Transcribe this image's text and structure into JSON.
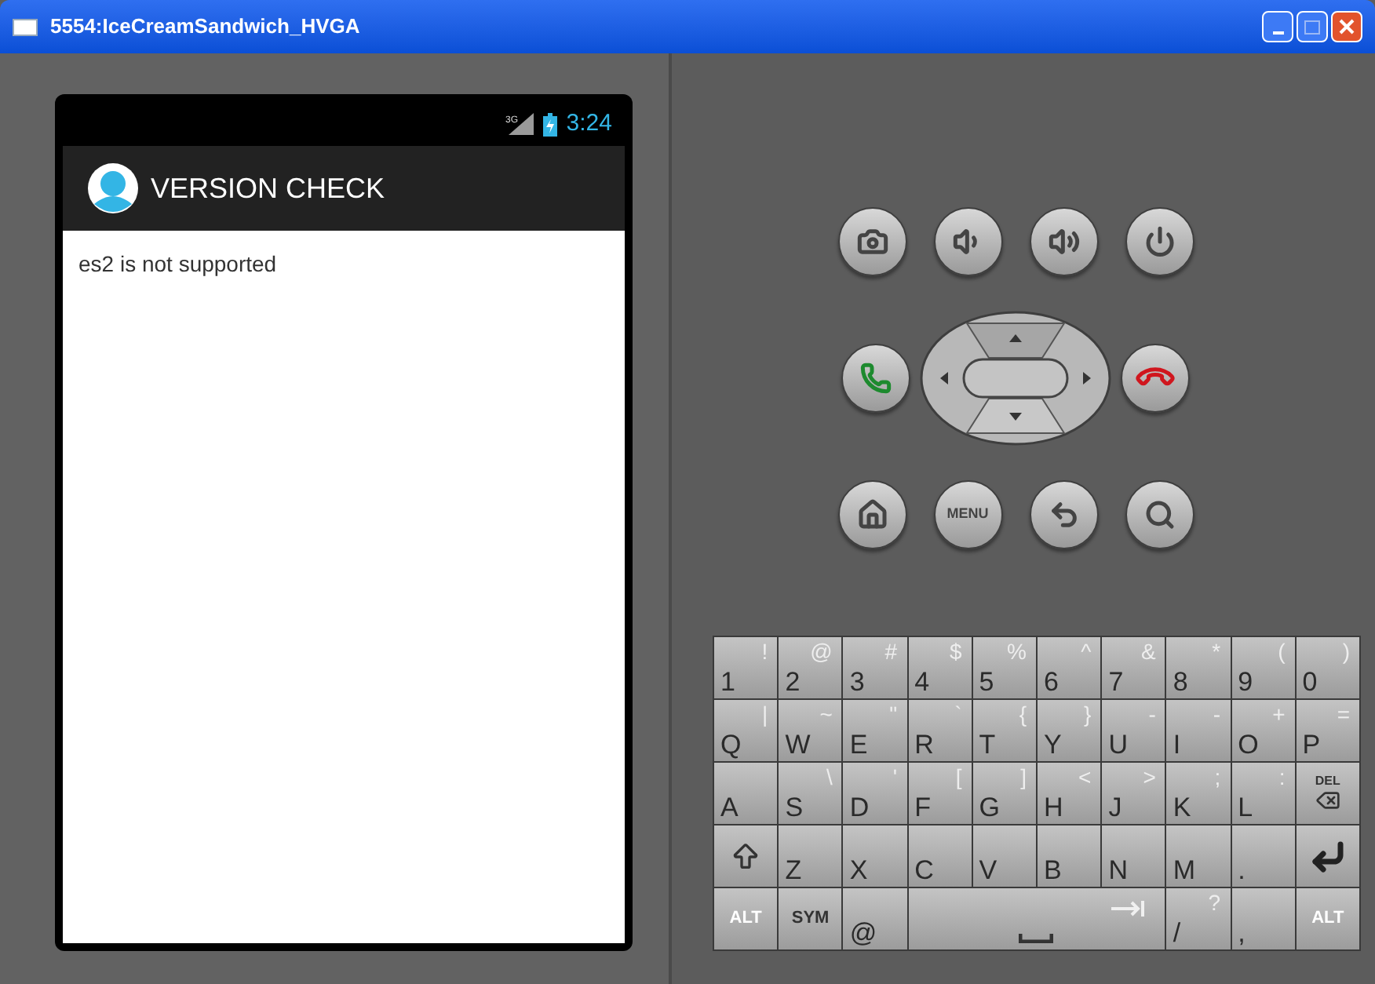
{
  "window": {
    "title": "5554:IceCreamSandwich_HVGA"
  },
  "phone": {
    "status_bar": {
      "network": "3G",
      "time": "3:24"
    },
    "action_bar": {
      "title": "VERSION CHECK"
    },
    "content": {
      "message": "es2 is not supported"
    }
  },
  "hardware_buttons": [
    {
      "kind": "camera"
    },
    {
      "kind": "volume_down"
    },
    {
      "kind": "volume_up"
    },
    {
      "kind": "power"
    },
    {
      "kind": "call"
    },
    {
      "kind": "dpad"
    },
    {
      "kind": "end_call"
    },
    {
      "kind": "home"
    },
    {
      "kind": "menu",
      "label": "MENU"
    },
    {
      "kind": "back"
    },
    {
      "kind": "search"
    }
  ],
  "keyboard": {
    "rows": [
      [
        {
          "kind": "char",
          "label": "1",
          "alt": "!"
        },
        {
          "kind": "char",
          "label": "2",
          "alt": "@"
        },
        {
          "kind": "char",
          "label": "3",
          "alt": "#"
        },
        {
          "kind": "char",
          "label": "4",
          "alt": "$"
        },
        {
          "kind": "char",
          "label": "5",
          "alt": "%"
        },
        {
          "kind": "char",
          "label": "6",
          "alt": "^"
        },
        {
          "kind": "char",
          "label": "7",
          "alt": "&"
        },
        {
          "kind": "char",
          "label": "8",
          "alt": "*"
        },
        {
          "kind": "char",
          "label": "9",
          "alt": "("
        },
        {
          "kind": "char",
          "label": "0",
          "alt": ")"
        }
      ],
      [
        {
          "kind": "char",
          "label": "Q",
          "alt": "|"
        },
        {
          "kind": "char",
          "label": "W",
          "alt": "~"
        },
        {
          "kind": "char",
          "label": "E",
          "alt": "\""
        },
        {
          "kind": "char",
          "label": "R",
          "alt": "`"
        },
        {
          "kind": "char",
          "label": "T",
          "alt": "{"
        },
        {
          "kind": "char",
          "label": "Y",
          "alt": "}"
        },
        {
          "kind": "char",
          "label": "U",
          "alt": "-"
        },
        {
          "kind": "char",
          "label": "I",
          "alt": "-"
        },
        {
          "kind": "char",
          "label": "O",
          "alt": "+"
        },
        {
          "kind": "char",
          "label": "P",
          "alt": "="
        }
      ],
      [
        {
          "kind": "char",
          "label": "A"
        },
        {
          "kind": "char",
          "label": "S",
          "alt": "\\"
        },
        {
          "kind": "char",
          "label": "D",
          "alt": "'"
        },
        {
          "kind": "char",
          "label": "F",
          "alt": "["
        },
        {
          "kind": "char",
          "label": "G",
          "alt": "]"
        },
        {
          "kind": "char",
          "label": "H",
          "alt": "<"
        },
        {
          "kind": "char",
          "label": "J",
          "alt": ">"
        },
        {
          "kind": "char",
          "label": "K",
          "alt": ";"
        },
        {
          "kind": "char",
          "label": "L",
          "alt": ":"
        },
        {
          "kind": "del",
          "label": "DEL"
        }
      ],
      [
        {
          "kind": "shift"
        },
        {
          "kind": "char",
          "label": "Z"
        },
        {
          "kind": "char",
          "label": "X"
        },
        {
          "kind": "char",
          "label": "C"
        },
        {
          "kind": "char",
          "label": "V"
        },
        {
          "kind": "char",
          "label": "B"
        },
        {
          "kind": "char",
          "label": "N"
        },
        {
          "kind": "char",
          "label": "M"
        },
        {
          "kind": "char",
          "label": "."
        },
        {
          "kind": "enter"
        }
      ],
      [
        {
          "kind": "alt",
          "label": "ALT"
        },
        {
          "kind": "sym",
          "label": "SYM"
        },
        {
          "kind": "char",
          "label": "@"
        },
        {
          "kind": "space"
        },
        "",
        "",
        "",
        {
          "kind": "char",
          "label": "/",
          "alt": "?"
        },
        {
          "kind": "char",
          "label": ","
        },
        {
          "kind": "alt",
          "label": "ALT"
        }
      ]
    ]
  }
}
